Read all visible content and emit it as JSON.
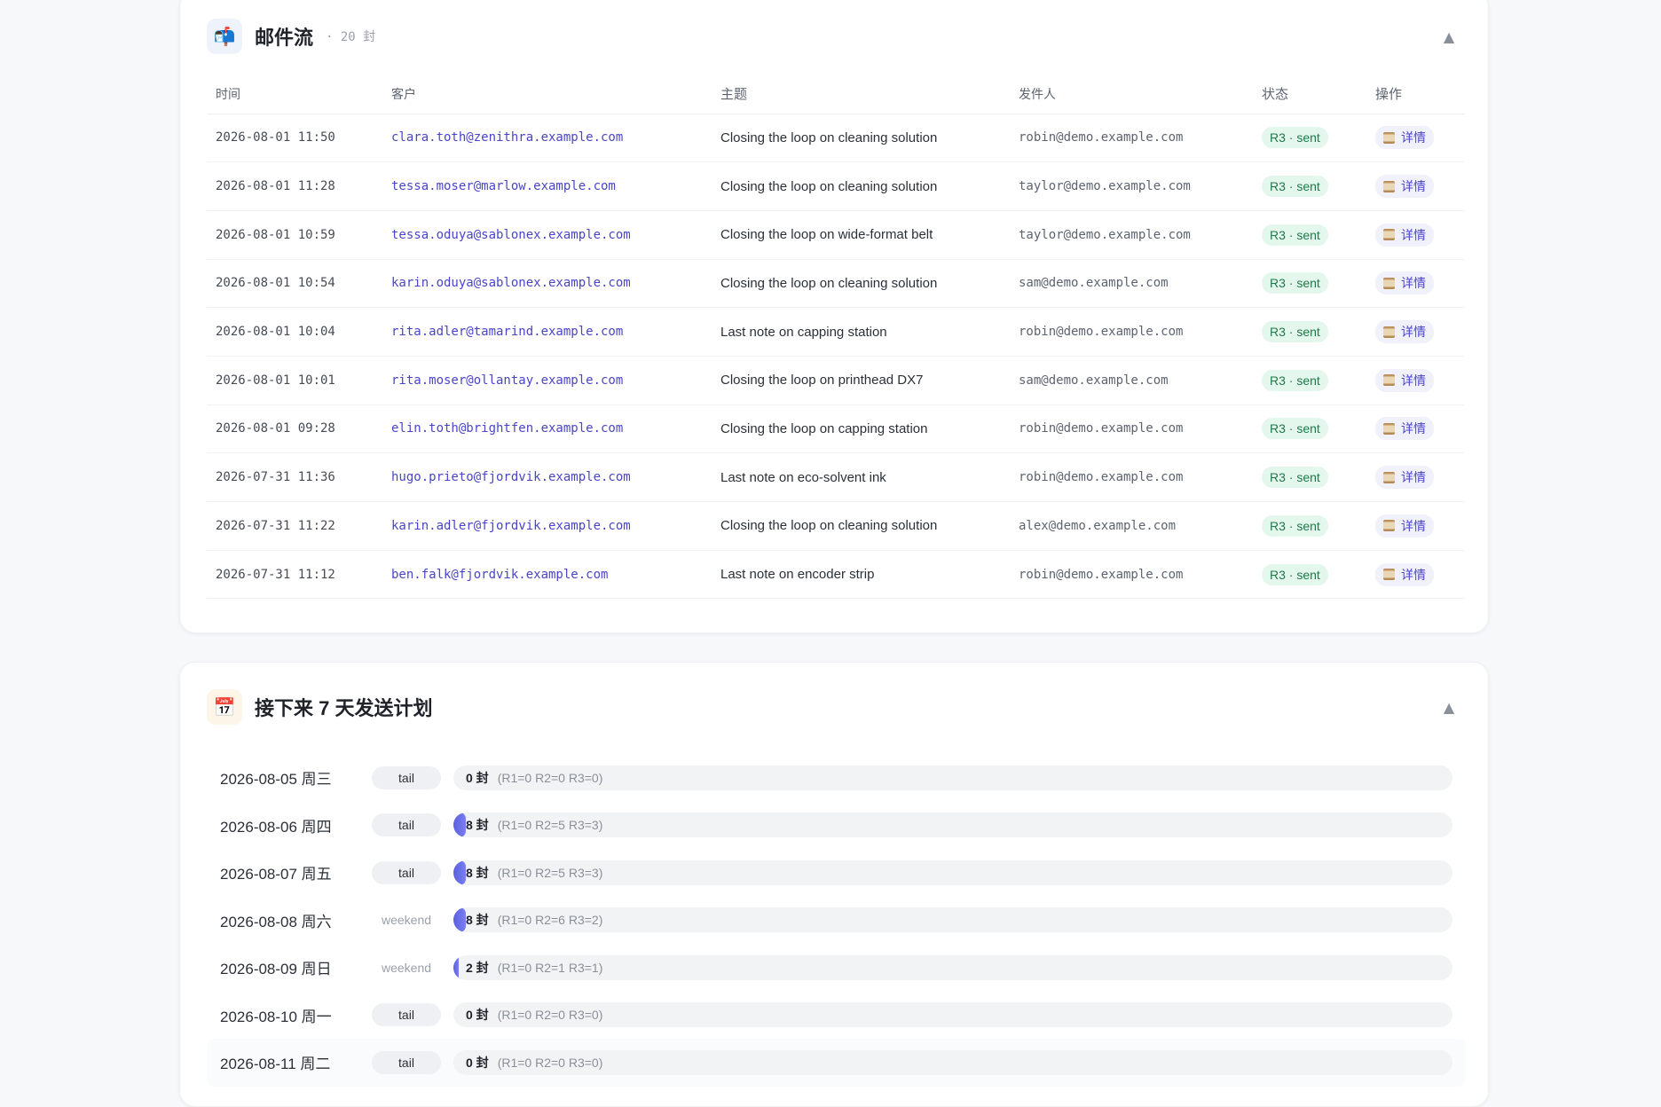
{
  "mail_flow": {
    "icon": "mailbox-icon",
    "title": "邮件流",
    "count_text": "· 20 封",
    "collapse": "▲",
    "columns": [
      "时间",
      "客户",
      "主题",
      "发件人",
      "状态",
      "操作"
    ],
    "detail_label": "详情",
    "rows": [
      {
        "time": "2026-08-01 11:50",
        "customer": "clara.toth@zenithra.example.com",
        "subject": "Closing the loop on cleaning solution",
        "sender": "robin@demo.example.com",
        "status": "R3 · sent"
      },
      {
        "time": "2026-08-01 11:28",
        "customer": "tessa.moser@marlow.example.com",
        "subject": "Closing the loop on cleaning solution",
        "sender": "taylor@demo.example.com",
        "status": "R3 · sent"
      },
      {
        "time": "2026-08-01 10:59",
        "customer": "tessa.oduya@sablonex.example.com",
        "subject": "Closing the loop on wide-format belt",
        "sender": "taylor@demo.example.com",
        "status": "R3 · sent"
      },
      {
        "time": "2026-08-01 10:54",
        "customer": "karin.oduya@sablonex.example.com",
        "subject": "Closing the loop on cleaning solution",
        "sender": "sam@demo.example.com",
        "status": "R3 · sent"
      },
      {
        "time": "2026-08-01 10:04",
        "customer": "rita.adler@tamarind.example.com",
        "subject": "Last note on capping station",
        "sender": "robin@demo.example.com",
        "status": "R3 · sent"
      },
      {
        "time": "2026-08-01 10:01",
        "customer": "rita.moser@ollantay.example.com",
        "subject": "Closing the loop on printhead DX7",
        "sender": "sam@demo.example.com",
        "status": "R3 · sent"
      },
      {
        "time": "2026-08-01 09:28",
        "customer": "elin.toth@brightfen.example.com",
        "subject": "Closing the loop on capping station",
        "sender": "robin@demo.example.com",
        "status": "R3 · sent"
      },
      {
        "time": "2026-07-31 11:36",
        "customer": "hugo.prieto@fjordvik.example.com",
        "subject": "Last note on eco-solvent ink",
        "sender": "robin@demo.example.com",
        "status": "R3 · sent"
      },
      {
        "time": "2026-07-31 11:22",
        "customer": "karin.adler@fjordvik.example.com",
        "subject": "Closing the loop on cleaning solution",
        "sender": "alex@demo.example.com",
        "status": "R3 · sent"
      },
      {
        "time": "2026-07-31 11:12",
        "customer": "ben.falk@fjordvik.example.com",
        "subject": "Last note on encoder strip",
        "sender": "robin@demo.example.com",
        "status": "R3 · sent"
      }
    ]
  },
  "send_plan": {
    "icon": "calendar-icon",
    "title": "接下来 7 天发送计划",
    "collapse": "▲",
    "rows": [
      {
        "date": "2026-08-05 周三",
        "tag": "tail",
        "count": "0 封",
        "detail": "(R1=0 R2=0 R3=0)",
        "fill": 0.0
      },
      {
        "date": "2026-08-06 周四",
        "tag": "tail",
        "count": "8 封",
        "detail": "(R1=0 R2=5 R3=3)",
        "fill": 0.012
      },
      {
        "date": "2026-08-07 周五",
        "tag": "tail",
        "count": "8 封",
        "detail": "(R1=0 R2=5 R3=3)",
        "fill": 0.012
      },
      {
        "date": "2026-08-08 周六",
        "tag": "weekend",
        "count": "8 封",
        "detail": "(R1=0 R2=6 R3=2)",
        "fill": 0.012
      },
      {
        "date": "2026-08-09 周日",
        "tag": "weekend",
        "count": "2 封",
        "detail": "(R1=0 R2=1 R3=1)",
        "fill": 0.003
      },
      {
        "date": "2026-08-10 周一",
        "tag": "tail",
        "count": "0 封",
        "detail": "(R1=0 R2=0 R3=0)",
        "fill": 0.0
      },
      {
        "date": "2026-08-11 周二",
        "tag": "tail",
        "count": "0 封",
        "detail": "(R1=0 R2=0 R3=0)",
        "fill": 0.0
      }
    ]
  },
  "colors": {
    "accent": "#5b5fe0",
    "link": "#4a45c8",
    "status_bg": "#e3f7ec",
    "status_text": "#1f7a4a"
  }
}
